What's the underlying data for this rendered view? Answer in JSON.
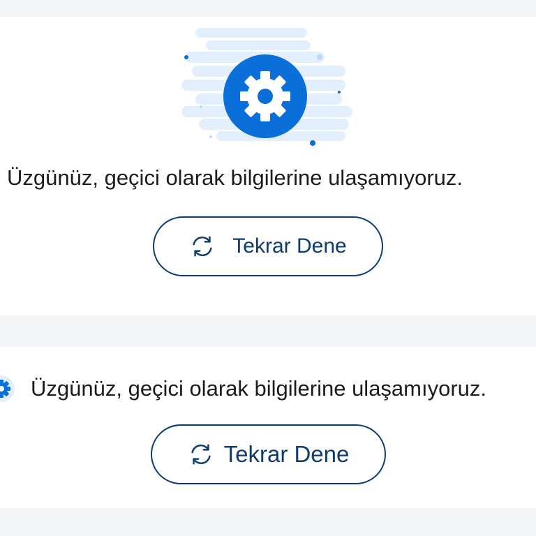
{
  "colors": {
    "accent": "#0a6fd8",
    "button_border": "#0d3c73",
    "button_text": "#0d3c73",
    "text": "#1c1c1c",
    "background": "#f4f5f7",
    "card": "#ffffff",
    "cloud": "#e3effd"
  },
  "error_card_large": {
    "illustration_icon": "gear-icon",
    "message": "Üzgünüz, geçici olarak bilgilerine ulaşamıyoruz.",
    "retry_button": {
      "icon": "refresh-icon",
      "label": "Tekrar Dene"
    }
  },
  "error_card_compact": {
    "icon": "gear-icon",
    "message": "Üzgünüz, geçici olarak bilgilerine ulaşamıyoruz.",
    "retry_button": {
      "icon": "refresh-icon",
      "label": "Tekrar Dene"
    }
  }
}
